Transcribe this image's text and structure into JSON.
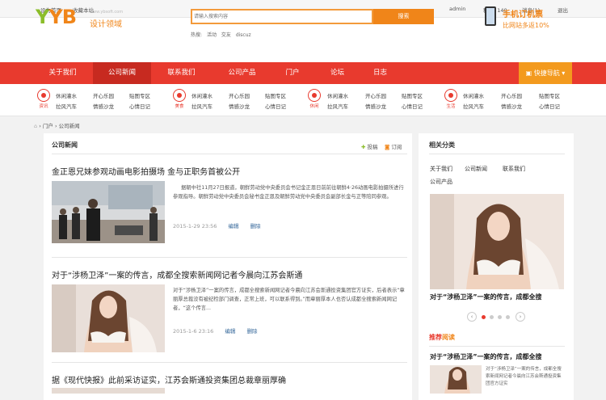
{
  "topbar": {
    "set_home": "设为首页",
    "bookmark": "收藏本站",
    "user": "admin",
    "points": "积分: 140",
    "messages": "消息(1)",
    "logout": "退出"
  },
  "header": {
    "logo_mark": "YB",
    "logo_text": "设计领域",
    "logo_url": "www.ybsoft.com",
    "search_placeholder": "请输入搜索内容",
    "search_type": "贴子",
    "search_button": "搜索",
    "hot_label": "热搜:",
    "hot_terms": [
      "活动",
      "交友",
      "discuz"
    ],
    "promo_line1": "手机订机票",
    "promo_line2": "比网站多返10%"
  },
  "nav": {
    "items": [
      "关于我们",
      "公司新闻",
      "联系我们",
      "公司产品",
      "门户",
      "论坛",
      "日志"
    ],
    "quick_nav": "快捷导航"
  },
  "subnav": {
    "groups": [
      {
        "icon_label": "资讯",
        "links": [
          "休闲灌水",
          "开心乐园",
          "贴图专区",
          "拉风汽车",
          "情感沙龙",
          "心情日记"
        ]
      },
      {
        "icon_label": "美食",
        "links": [
          "休闲灌水",
          "开心乐园",
          "贴图专区",
          "拉风汽车",
          "情感沙龙",
          "心情日记"
        ]
      },
      {
        "icon_label": "休闲",
        "links": [
          "休闲灌水",
          "开心乐园",
          "贴图专区",
          "拉风汽车",
          "情感沙龙",
          "心情日记"
        ]
      },
      {
        "icon_label": "生活",
        "links": [
          "休闲灌水",
          "开心乐园",
          "贴图专区",
          "拉风汽车",
          "情感沙龙",
          "心情日记"
        ]
      }
    ]
  },
  "breadcrumb": {
    "portal": "门户",
    "current": "公司新闻"
  },
  "main": {
    "title": "公司新闻",
    "post_button": "投稿",
    "rss": "订阅",
    "articles": [
      {
        "title": "金正恩兄妹参观动画电影拍摄场 金与正职务首被公开",
        "summary": "据朝中社11月27日报道，朝鲜劳动党中央委员会书记金正恩日前前往朝鲜4·26动画电影拍摄所进行参观指导。朝鲜劳动党中央委员会秘书金正恩及朝鲜劳动党中央委员会副部长金与正等陪同参观。",
        "date": "2015-1-29 23:56",
        "edit": "编辑",
        "delete": "删除"
      },
      {
        "title": "对于“涉杨卫泽”一案的传言，成都全搜索新闻网记者今晨向江苏会斯通",
        "summary": "对于“涉杨卫泽”一案的传言，成都全搜索新闻网记者今晨向江苏会斯通投资集团官方证实，后者表示“章丽厚总裁没有被纪检部门调查，正常上班，可以联系得到。”而章丽厚本人也否认成都全搜索新闻网记者，“这个传言...",
        "date": "2015-1-6 23:16",
        "edit": "编辑",
        "delete": "删除"
      },
      {
        "title": "据《现代快报》此前采访证实，江苏会斯通投资集团总裁章丽厚确"
      }
    ]
  },
  "sidebar": {
    "related_title": "相关分类",
    "related_links": [
      "关于我们",
      "公司新闻",
      "联系我们",
      "公司产品"
    ],
    "slide_caption": "对于“涉杨卫泽”一案的传言，成都全搜",
    "recommended_title_a": "推荐",
    "recommended_title_b": "阅读",
    "rec_title": "对于“涉杨卫泽”一案的传言，成都全搜",
    "rec_summary": "对于“涉杨卫泽”一案的传言，成都全搜索新闻网记者今晨向江苏会斯通投资集团官方证实",
    "arrow_prev": "‹",
    "arrow_next": "›"
  },
  "colors": {
    "nav_red": "#e83a2e",
    "accent_orange": "#f08519",
    "quick_nav": "#f39a1e"
  }
}
